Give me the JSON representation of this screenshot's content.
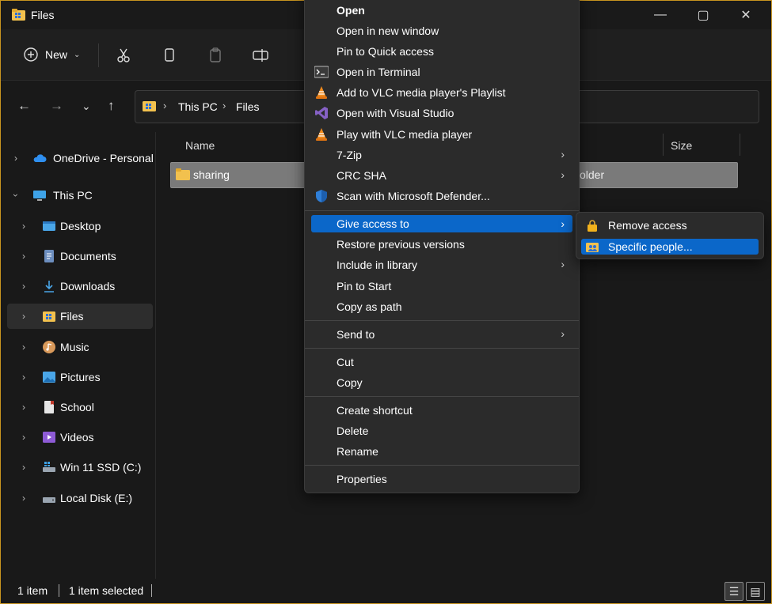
{
  "window": {
    "title": "Files",
    "minimize_glyph": "—",
    "maximize_glyph": "▢",
    "close_glyph": "✕"
  },
  "toolbar": {
    "new_label": "New",
    "new_icon": "plus-circle-icon",
    "cut_icon": "scissors-icon",
    "copy_icon": "copy-icon",
    "paste_icon": "paste-icon",
    "rename_icon": "rename-icon"
  },
  "address": {
    "segments": [
      "This PC",
      "Files"
    ]
  },
  "sidebar": {
    "items": [
      {
        "label": "OneDrive - Personal",
        "icon": "cloud-icon"
      },
      {
        "label": "This PC",
        "icon": "monitor-icon"
      },
      {
        "label": "Desktop",
        "icon": "desktop-icon"
      },
      {
        "label": "Documents",
        "icon": "documents-icon"
      },
      {
        "label": "Downloads",
        "icon": "download-icon"
      },
      {
        "label": "Files",
        "icon": "folder-icon"
      },
      {
        "label": "Music",
        "icon": "music-icon"
      },
      {
        "label": "Pictures",
        "icon": "pictures-icon"
      },
      {
        "label": "School",
        "icon": "school-icon"
      },
      {
        "label": "Videos",
        "icon": "videos-icon"
      },
      {
        "label": "Win 11 SSD (C:)",
        "icon": "drive-icon"
      },
      {
        "label": "Local Disk (E:)",
        "icon": "drive-icon"
      }
    ]
  },
  "content": {
    "columns": {
      "name": "Name",
      "size": "Size"
    },
    "rows": [
      {
        "name": "sharing",
        "type": "older"
      }
    ]
  },
  "context_menu": {
    "items": [
      {
        "label": "Open",
        "bold": true,
        "icon": ""
      },
      {
        "label": "Open in new window",
        "icon": ""
      },
      {
        "label": "Pin to Quick access",
        "icon": ""
      },
      {
        "label": "Open in Terminal",
        "icon": "terminal-icon"
      },
      {
        "label": "Add to VLC media player's Playlist",
        "icon": "vlc-icon"
      },
      {
        "label": "Open with Visual Studio",
        "icon": "visual-studio-icon"
      },
      {
        "label": "Play with VLC media player",
        "icon": "vlc-icon"
      },
      {
        "label": "7-Zip",
        "icon": "",
        "submenu": true
      },
      {
        "label": "CRC SHA",
        "icon": "",
        "submenu": true
      },
      {
        "label": "Scan with Microsoft Defender...",
        "icon": "defender-shield-icon"
      },
      {
        "label": "Give access to",
        "icon": "",
        "submenu": true,
        "highlighted": true
      },
      {
        "label": "Restore previous versions",
        "icon": ""
      },
      {
        "label": "Include in library",
        "icon": "",
        "submenu": true
      },
      {
        "label": "Pin to Start",
        "icon": ""
      },
      {
        "label": "Copy as path",
        "icon": ""
      },
      {
        "label": "Send to",
        "icon": "",
        "submenu": true
      },
      {
        "label": "Cut",
        "icon": ""
      },
      {
        "label": "Copy",
        "icon": ""
      },
      {
        "label": "Create shortcut",
        "icon": ""
      },
      {
        "label": "Delete",
        "icon": ""
      },
      {
        "label": "Rename",
        "icon": ""
      },
      {
        "label": "Properties",
        "icon": ""
      }
    ],
    "arrow": "›"
  },
  "submenu": {
    "items": [
      {
        "label": "Remove access",
        "icon": "lock-icon"
      },
      {
        "label": "Specific people...",
        "icon": "shared-folder-icon",
        "highlighted": true
      }
    ]
  },
  "status": {
    "count": "1 item",
    "selected": "1 item selected"
  },
  "colors": {
    "accent": "#0b67c9",
    "folder": "#f2c14e",
    "window_border": "#c89420"
  }
}
